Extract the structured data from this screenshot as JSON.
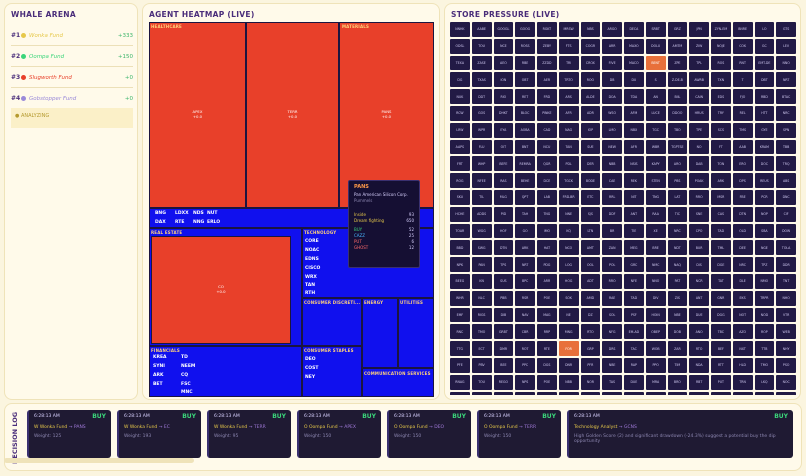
{
  "arena": {
    "title": "WHALE ARENA",
    "analyzing": "● ANALYZING",
    "rows": [
      {
        "rank": "#1",
        "name": "Wonka Fund",
        "pl": "+333",
        "color": "#e6c84a",
        "plcolor": "#3bb56a"
      },
      {
        "rank": "#2",
        "name": "Oompa Fund",
        "pl": "+150",
        "color": "#3bd57a",
        "plcolor": "#3bb56a"
      },
      {
        "rank": "#3",
        "name": "Slugworth Fund",
        "pl": "+0",
        "color": "#e8402a",
        "plcolor": "#3bb56a"
      },
      {
        "rank": "#4",
        "name": "Gobstopper Fund",
        "pl": "+0",
        "color": "#9a8ad9",
        "plcolor": "#3bb56a"
      }
    ]
  },
  "heatmap": {
    "title": "AGENT HEATMAP (LIVE)",
    "sectors": [
      "HEALTHCARE",
      "MATERIALS",
      "REAL ESTATE",
      "TECHNOLOGY",
      "FINANCIALS",
      "CONSUMER DISCRETI...",
      "ENERGY",
      "UTILITIES",
      "CONSUMER STAPLES",
      "COMMUNICATION SERVICES"
    ],
    "cells": [
      {
        "t": "APEX",
        "v": "+0.0"
      },
      {
        "t": "TERR",
        "v": "+0.0"
      },
      {
        "t": "PANS",
        "v": "+0.0"
      },
      {
        "t": "CO",
        "v": "+0.0"
      }
    ],
    "blue_labels_hc": [
      "BNG",
      "LDXX",
      "NDS",
      "NUT",
      "DAX",
      "RTE",
      "NNG",
      "ERLO"
    ],
    "tech_labels": [
      "CORE",
      "NOAC",
      "EDNS",
      "CISCO",
      "WRX",
      "TAN",
      "RTH"
    ],
    "fin_labels": [
      "KREA",
      "SYNI",
      "ARK",
      "BET",
      "TD",
      "NEEM",
      "CQ",
      "FSC",
      "MNC"
    ],
    "staples_labels": [
      "DEO",
      "COST",
      "NEY"
    ],
    "tooltip": {
      "ticker": "PANS",
      "name": "Pan American Silicon Corp.",
      "sub": "Pummels",
      "k1": "Inside",
      "v1": "93",
      "k2": "Dream fighting",
      "v2": "650",
      "k3": "BUY",
      "v3": "52",
      "k4": "CAZZ",
      "v4": "25",
      "k5": "PUT",
      "v5": "6",
      "k6": "GHOST",
      "v6": "12"
    }
  },
  "store": {
    "title": "STORE PRESSURE (LIVE)",
    "tickers": [
      "NNHK",
      "AABE",
      "GOOGL",
      "GOOG",
      "RGKT",
      "MRSW",
      "NBS",
      "ARGO",
      "DECA",
      "SRBT",
      "GRZ",
      "JPN",
      "ZYN-EM",
      "BNRE",
      "LO",
      "GTS",
      "ODSL",
      "TOU",
      "NCE",
      "ROSS",
      "ZEBY",
      "FTS",
      "COGR",
      "ARR",
      "MAXO",
      "DOLX",
      "AMTM",
      "ZIW",
      "NOJE",
      "COK",
      "GC",
      "LEV",
      "TEXA",
      "ZASE",
      "AEO",
      "RBE",
      "ZZDD",
      "TRI",
      "CROX",
      "FIVE",
      "MACO",
      "BENT",
      "ZPE",
      "TPL",
      "ROS",
      "RNT",
      "EMT-DE",
      "NNO",
      "DG",
      "TXAS",
      "ION",
      "OBT",
      "AER",
      "TRTO",
      "ROO",
      "DB",
      "DU",
      "S",
      "Z-DE-B",
      "AWRB",
      "TXN",
      "T",
      "DBT",
      "NRT",
      "NUK",
      "DDT",
      "RIO",
      "RET",
      "FRD",
      "ARS",
      "ALDE",
      "DOA",
      "TDA",
      "AN",
      "BIIL",
      "CAIN",
      "EDS",
      "FJO",
      "RBD",
      "BTAC",
      "RCW",
      "GOS",
      "DHKT",
      "BLOC",
      "PINKE",
      "AFR",
      "ADR",
      "WSO",
      "AFM",
      "LUCE",
      "DDOO",
      "HRUS",
      "TRY",
      "REL",
      "HTT",
      "NRC",
      "LRW",
      "WPR",
      "EYA",
      "AOBA",
      "CAD",
      "NAG",
      "IOP",
      "LMO",
      "NBX",
      "TGC",
      "TBO",
      "TPE",
      "SCS",
      "TMS",
      "GYE",
      "SPN",
      "AAPS",
      "FLU",
      "OIT",
      "BNT",
      "NCU",
      "TAN",
      "SUE",
      "NEW",
      "AFR",
      "WBR",
      "TGPTSE",
      "NO",
      "FT",
      "AAB",
      "KRAM",
      "TBB",
      "FRT",
      "WHP",
      "BEFE",
      "REMRA",
      "QGR",
      "PDL",
      "DER",
      "NBB",
      "NSIS",
      "KAPY",
      "ARO",
      "DAB",
      "TON",
      "ERO",
      "DOC",
      "TRQ",
      "ROG",
      "NFEE",
      "RAS",
      "BEHE",
      "DCE",
      "TGCK",
      "BODE",
      "CAE",
      "REK",
      "STEN",
      "PBS",
      "POAK",
      "ARK",
      "DPS",
      "REUS",
      "ABS",
      "SKU",
      "TIL",
      "MLG",
      "QPT",
      "LAB",
      "FRD-BR",
      "ETC",
      "RRL",
      "NIT",
      "TNG",
      "LAT",
      "RRO",
      "MSR",
      "FBE",
      "PCR",
      "DNC",
      "HCHE",
      "ADDS",
      "PID",
      "TAH",
      "TNG",
      "NNE",
      "SJS",
      "DDF",
      "ANT",
      "RAA",
      "TIC",
      "SNE",
      "CAS",
      "DTN",
      "NOP",
      "CIF",
      "TOAR",
      "WGG",
      "HOF",
      "GO",
      "IMO",
      "KQ",
      "LTN",
      "BR",
      "TIE",
      "XE",
      "NRC",
      "CPO",
      "TAD",
      "OLD",
      "SBA",
      "DOW",
      "BBD",
      "SWG",
      "DTN",
      "ARK",
      "HAT",
      "NCO",
      "AMT",
      "ZAN",
      "MEG",
      "BRE",
      "NDT",
      "BUR",
      "TML",
      "DEE",
      "NGE",
      "TOLA",
      "NPK",
      "PAN",
      "TPS",
      "NRT",
      "PDG",
      "LOG",
      "OOL",
      "POL",
      "GRC",
      "NMC",
      "NAQ",
      "DIS",
      "DGE",
      "NRC",
      "TPZ",
      "DDR",
      "BEEG",
      "KN",
      "SUS",
      "BPC",
      "ARR",
      "HOG",
      "ADT",
      "RRO",
      "NFE",
      "NNO",
      "PAT",
      "NCR",
      "TAT",
      "DLE",
      "NMO",
      "TNT",
      "WHR",
      "NLC",
      "PBB",
      "RSR",
      "POE",
      "SOK",
      "AMD",
      "RAE",
      "TAD",
      "DIV",
      "ZIS",
      "ANT",
      "GNR",
      "EKS",
      "TRPR",
      "NHO",
      "EMF",
      "RIGS",
      "DIB",
      "NAV",
      "MAG",
      "NE",
      "DZ",
      "SOL",
      "PSF",
      "HOIN",
      "NBE",
      "DUE",
      "DGG",
      "NOT",
      "NOD",
      "VTR",
      "RNC",
      "TMO",
      "GRBT",
      "CBR",
      "RRP",
      "MNG",
      "RTO",
      "NFG",
      "EM-AD",
      "OBEP",
      "DOB",
      "ANO",
      "TBC",
      "AZO",
      "ROP",
      "WEB",
      "TTG",
      "ECT",
      "DMR",
      "ROT",
      "RTE",
      "FOR",
      "GRP",
      "DRS",
      "TAC",
      "WOB",
      "ZAR",
      "RTO",
      "BEF",
      "NXT",
      "TTB",
      "NHY",
      "PFE",
      "PBV",
      "BEE",
      "PPC",
      "DGS",
      "DNR",
      "PFR",
      "NBE",
      "RAP",
      "PPO",
      "TIM",
      "NDA",
      "RTT",
      "HLD",
      "TMO",
      "PSO",
      "RNAG",
      "TOU",
      "REGO",
      "NPS",
      "POE",
      "NBB",
      "NOR",
      "TAS",
      "DUE",
      "MRA",
      "BRO",
      "RBT",
      "PUT",
      "TRN",
      "LKQ",
      "NOC",
      "RHDE",
      "OCT",
      "TWE",
      "TML",
      "NIE",
      "STNS",
      "OAT",
      "PHD",
      "DNR",
      "DOBO",
      "DIR",
      "PTO",
      "STO",
      "OCL",
      "PUB",
      "TBC",
      "FIRS",
      "RRE",
      "BET",
      "NMA",
      "DLT",
      "DER",
      "NVSQ",
      "PHS",
      "TIR",
      "PPE",
      "CPS",
      "ROB",
      "GDN",
      "EO",
      "TAB",
      "NPC"
    ],
    "hot_indices": [
      41,
      309
    ]
  },
  "decisions": {
    "title": "DECISION LOG",
    "cards": [
      {
        "time": "6:28:13 AM",
        "action": "BUY",
        "fund": "W Wonka Fund",
        "target": "→ PANS",
        "weight": "Weight: 125"
      },
      {
        "time": "6:28:13 AM",
        "action": "BUY",
        "fund": "W Wonka Fund",
        "target": "→ EC",
        "weight": "Weight: 193"
      },
      {
        "time": "6:28:13 AM",
        "action": "BUY",
        "fund": "W Wonka Fund",
        "target": "→ TERR",
        "weight": "Weight: 95"
      },
      {
        "time": "6:28:13 AM",
        "action": "BUY",
        "fund": "O Oompa Fund",
        "target": "→ APEX",
        "weight": "Weight: 150"
      },
      {
        "time": "6:28:13 AM",
        "action": "BUY",
        "fund": "O Oompa Fund",
        "target": "→ DEO",
        "weight": "Weight: 150"
      },
      {
        "time": "6:28:13 AM",
        "action": "BUY",
        "fund": "O Oompa Fund",
        "target": "→ TERR",
        "weight": "Weight: 150"
      },
      {
        "time": "6:28:13 AM",
        "action": "BUY",
        "fund": "Technology Analyst",
        "target": "→ GCNS",
        "weight": "High Golden Score (2) and significant drawdown (-24.3%) suggest a potential buy the dip opportunity"
      }
    ]
  }
}
